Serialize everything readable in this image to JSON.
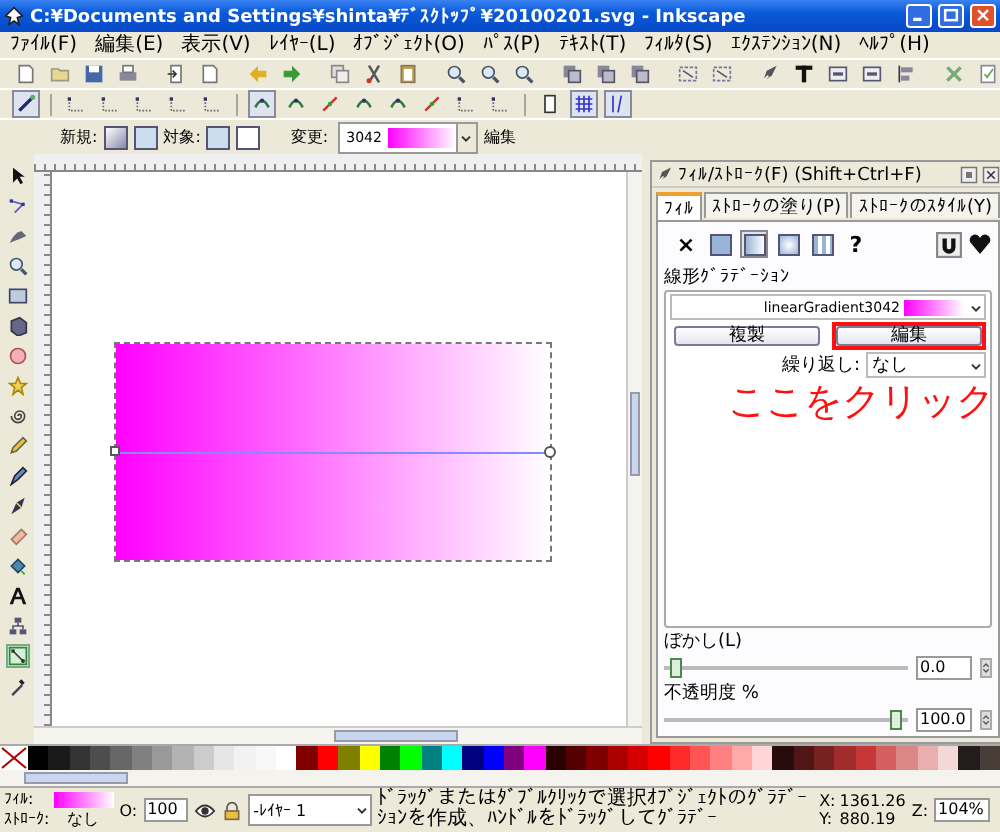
{
  "window": {
    "title": "C:¥Documents and Settings¥shinta¥ﾃﾞｽｸﾄｯﾌﾟ¥20100201.svg - Inkscape"
  },
  "menu": [
    "ﾌｧｲﾙ(F)",
    "編集(E)",
    "表示(V)",
    "ﾚｲﾔｰ(L)",
    "ｵﾌﾞｼﾞｪｸﾄ(O)",
    "ﾊﾟｽ(P)",
    "ﾃｷｽﾄ(T)",
    "ﾌｨﾙﾀ(S)",
    "ｴｸｽﾃﾝｼｮﾝ(N)",
    "ﾍﾙﾌﾟ(H)"
  ],
  "tool_controls": {
    "new_label": "新規:",
    "target_label": "対象:",
    "change_label": "変更:",
    "gradient_name": "3042",
    "edit_label": "編集"
  },
  "tools": [
    {
      "selected": false
    },
    {
      "selected": false
    },
    {
      "selected": false
    },
    {
      "selected": false
    },
    {
      "selected": false
    },
    {
      "selected": false
    },
    {
      "selected": false
    },
    {
      "selected": false
    },
    {
      "selected": false
    },
    {
      "selected": false
    },
    {
      "selected": false
    },
    {
      "selected": false
    },
    {
      "selected": false
    },
    {
      "selected": false
    },
    {
      "selected": false
    },
    {
      "selected": false
    },
    {
      "selected": true
    },
    {
      "selected": false
    }
  ],
  "dock": {
    "title": "ﾌｨﾙ/ｽﾄﾛｰｸ(F) (Shift+Ctrl+F)",
    "tabs": [
      {
        "label": "ﾌｨﾙ",
        "selected": true
      },
      {
        "label": "ｽﾄﾛｰｸの塗り(P)",
        "selected": false
      },
      {
        "label": "ｽﾄﾛｰｸのｽﾀｲﾙ(Y)",
        "selected": false
      }
    ],
    "paint_types": [
      {
        "kind": "none",
        "glyph": "×",
        "selected": false
      },
      {
        "kind": "flat",
        "selected": false
      },
      {
        "kind": "linear",
        "selected": true
      },
      {
        "kind": "radial",
        "selected": false
      },
      {
        "kind": "pattern",
        "selected": false
      },
      {
        "kind": "unset",
        "glyph": "?",
        "selected": false
      }
    ],
    "gradient_section": "線形ｸﾞﾗﾃﾞｰｼｮﾝ",
    "gradient_name": "linearGradient3042",
    "buttons": [
      "複製",
      "編集"
    ],
    "repeat_label": "繰り返し:",
    "repeat_value": "なし",
    "blur": {
      "label": "ぼかし(L)",
      "level": 0,
      "value": "0.0"
    },
    "opacity": {
      "label": "不透明度 %",
      "level": 1,
      "value": "100.0"
    }
  },
  "annotation": "ここをクリック",
  "palette": [
    {
      "color": "#000000"
    },
    {
      "color": "#1a1a1a"
    },
    {
      "color": "#333333"
    },
    {
      "color": "#4d4d4d"
    },
    {
      "color": "#666666"
    },
    {
      "color": "#808080"
    },
    {
      "color": "#999999"
    },
    {
      "color": "#b3b3b3"
    },
    {
      "color": "#cccccc"
    },
    {
      "color": "#e6e6e6"
    },
    {
      "color": "#f2f2f2"
    },
    {
      "color": "#f8f8f8"
    },
    {
      "color": "#ffffff"
    },
    {
      "color": "#800000"
    },
    {
      "color": "#ff0000"
    },
    {
      "color": "#808000"
    },
    {
      "color": "#ffff00"
    },
    {
      "color": "#008000"
    },
    {
      "color": "#00ff00"
    },
    {
      "color": "#008080"
    },
    {
      "color": "#00ffff"
    },
    {
      "color": "#000080"
    },
    {
      "color": "#0000ff"
    },
    {
      "color": "#800080"
    },
    {
      "color": "#ff00ff"
    },
    {
      "color": "#2b0000"
    },
    {
      "color": "#550000"
    },
    {
      "color": "#800000"
    },
    {
      "color": "#aa0000"
    },
    {
      "color": "#d40000"
    },
    {
      "color": "#ff0000"
    },
    {
      "color": "#ff2a2a"
    },
    {
      "color": "#ff5555"
    },
    {
      "color": "#ff8080"
    },
    {
      "color": "#ffaaaa"
    },
    {
      "color": "#ffd5d5"
    },
    {
      "color": "#280b0b"
    },
    {
      "color": "#501616"
    },
    {
      "color": "#782121"
    },
    {
      "color": "#a02c2c"
    },
    {
      "color": "#c83737"
    },
    {
      "color": "#d35f5f"
    },
    {
      "color": "#de8787"
    },
    {
      "color": "#e9afaf"
    },
    {
      "color": "#f4d7d7"
    },
    {
      "color": "#241c1c"
    },
    {
      "color": "#483e37"
    }
  ],
  "status_bar": {
    "fill_label": "ﾌｨﾙ:",
    "stroke_label": "ｽﾄﾛｰｸ:",
    "stroke_value": "なし",
    "opacity_label": "O:",
    "opacity_value": "100",
    "layer": "-ﾚｲﾔｰ 1",
    "message": "ﾄﾞﾗｯｸﾞまたはﾀﾞﾌﾞﾙｸﾘｯｸで選択ｵﾌﾞｼﾞｪｸﾄのｸﾞﾗﾃﾞｰｼｮﾝを作成、ﾊﾝﾄﾞﾙをﾄﾞﾗｯｸﾞしてｸﾞﾗﾃﾞｰ",
    "x_label": "X:",
    "x_value": "1361.26",
    "y_label": "Y:",
    "y_value": "880.19",
    "zoom_label": "Z:",
    "zoom_value": "104%"
  }
}
